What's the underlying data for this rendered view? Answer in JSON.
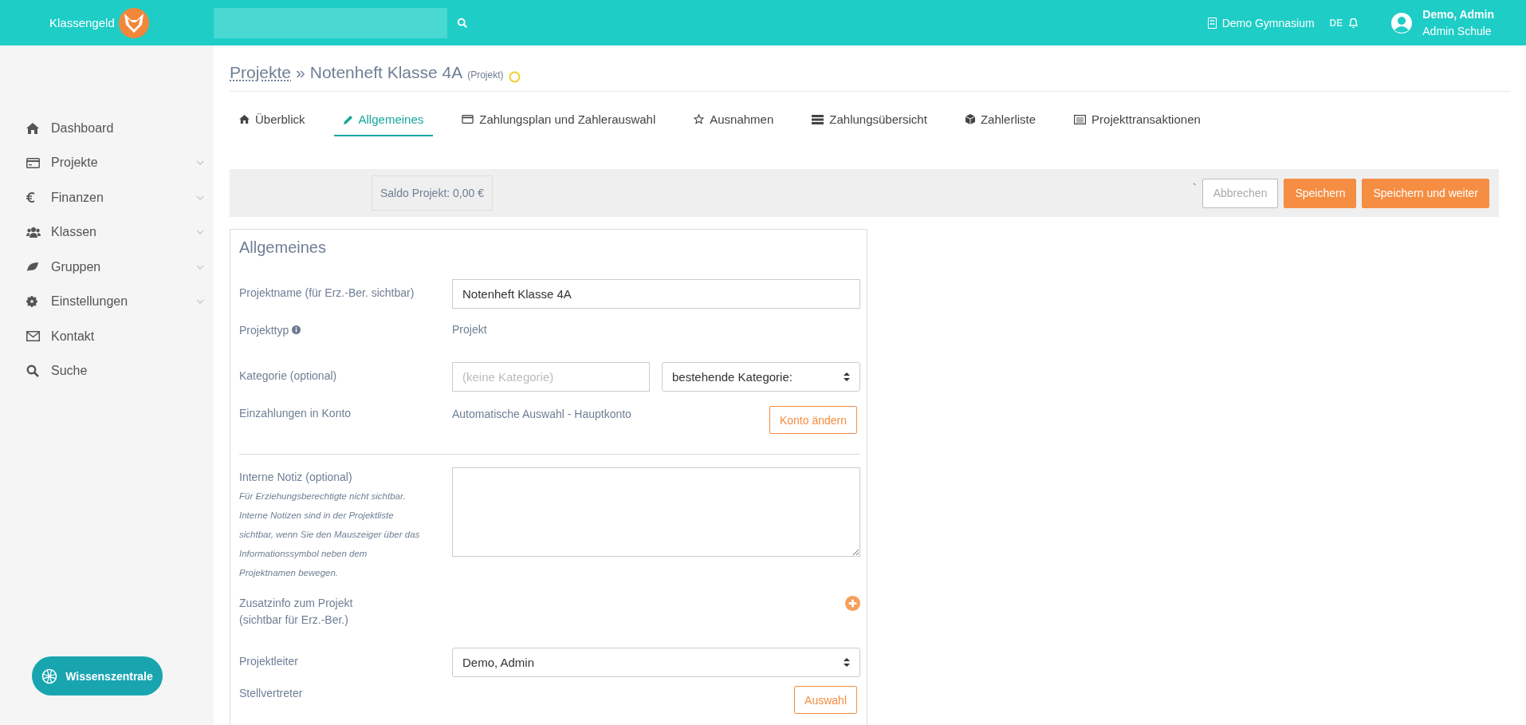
{
  "topbar": {
    "brand": "Klassengeld",
    "school": "Demo Gymnasium",
    "language": {
      "label": "DE",
      "selected": true
    },
    "user": {
      "name": "Demo, Admin",
      "role": "Admin Schule"
    }
  },
  "sidebar": {
    "items": [
      {
        "label": "Dashboard",
        "expandable": false
      },
      {
        "label": "Projekte",
        "expandable": true
      },
      {
        "label": "Finanzen",
        "expandable": true
      },
      {
        "label": "Klassen",
        "expandable": true
      },
      {
        "label": "Gruppen",
        "expandable": true
      },
      {
        "label": "Einstellungen",
        "expandable": true
      },
      {
        "label": "Kontakt",
        "expandable": false
      },
      {
        "label": "Suche",
        "expandable": false
      }
    ],
    "help_button": "Wissenszentrale"
  },
  "breadcrumb": {
    "parent": "Projekte",
    "separator": "»",
    "current": "Notenheft Klasse 4A",
    "type": "(Projekt)"
  },
  "tabs": [
    {
      "label": "Überblick",
      "selected": false
    },
    {
      "label": "Allgemeines",
      "selected": true
    },
    {
      "label": "Zahlungsplan und Zahlerauswahl",
      "selected": false
    },
    {
      "label": "Ausnahmen",
      "selected": false
    },
    {
      "label": "Zahlungsübersicht",
      "selected": false
    },
    {
      "label": "Zahlerliste",
      "selected": false
    },
    {
      "label": "Projekttransaktionen",
      "selected": false
    }
  ],
  "action_bar": {
    "balance": "Saldo Projekt: 0,00 €",
    "mark": "`",
    "buttons": [
      {
        "label": "Abbrechen",
        "kind": "secondary",
        "disabled": true
      },
      {
        "label": "Speichern",
        "kind": "primary",
        "disabled": false
      },
      {
        "label": "Speichern und weiter",
        "kind": "primary",
        "disabled": false
      }
    ]
  },
  "form": {
    "title": "Allgemeines",
    "rows": [
      {
        "kind": "input",
        "label": "Projektname (für Erz.-Ber. sichtbar)",
        "value": "Notenheft Klasse 4A"
      },
      {
        "kind": "text",
        "label": "Projekttyp",
        "info": true,
        "value": "Projekt"
      },
      {
        "kind": "category",
        "label": "Kategorie (optional)",
        "placeholder": "(keine Kategorie)",
        "select": "bestehende Kategorie:"
      },
      {
        "kind": "account",
        "label": "Einzahlungen in Konto",
        "value": "Automatische Auswahl - Hauptkonto",
        "button": "Konto ändern"
      },
      {
        "kind": "divider"
      },
      {
        "kind": "textarea",
        "label": "Interne Notiz (optional)",
        "hint": "Für Erziehungsberechtigte nicht sichtbar. Interne Notizen sind in der Projektliste sichtbar, wenn Sie den Mauszeiger über das Informationssymbol neben dem Projektnamen bewegen."
      },
      {
        "kind": "add",
        "label": "Zusatzinfo zum Projekt",
        "label_2": "(sichtbar für Erz.-Ber.)"
      },
      {
        "kind": "select",
        "label": "Projektleiter",
        "value": "Demo, Admin"
      },
      {
        "kind": "pick",
        "label": "Stellvertreter",
        "button": "Auswahl"
      }
    ]
  }
}
